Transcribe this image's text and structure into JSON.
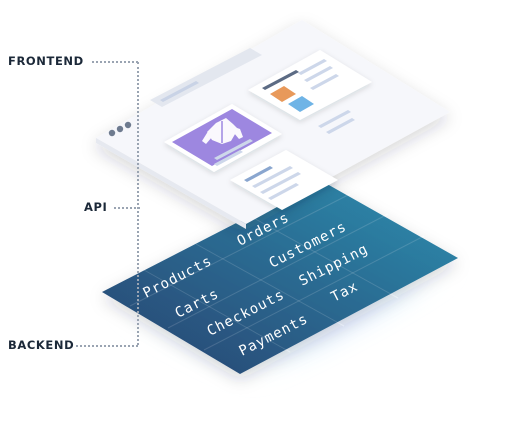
{
  "labels": {
    "frontend": "FRONTEND",
    "api": "API",
    "backend": "BACKEND"
  },
  "backend_modules": {
    "orders": "Orders",
    "products": "Products",
    "customers": "Customers",
    "carts": "Carts",
    "shipping": "Shipping",
    "checkouts": "Checkouts",
    "tax": "Tax",
    "payments": "Payments"
  },
  "colors": {
    "backend_gradient_start": "#27416f",
    "backend_gradient_end": "#2e8fb0",
    "product_card_accent": "#9d87e0",
    "swatch_orange": "#e8995a",
    "swatch_blue": "#6fb4e6",
    "text_dark": "#1b2838"
  },
  "icons": {
    "product_image": "jacket-icon",
    "window_controls": "window-dots-icon"
  }
}
